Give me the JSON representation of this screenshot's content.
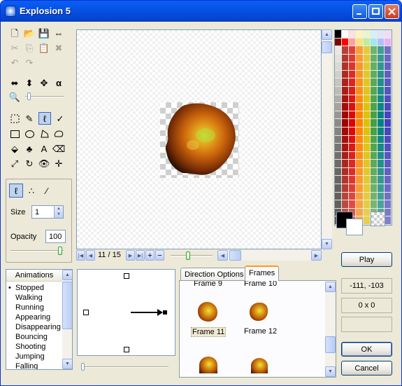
{
  "window": {
    "title": "Explosion 5"
  },
  "tools": {
    "file_row": [
      "new-icon",
      "open-icon",
      "save-icon",
      "resize-icon"
    ],
    "edit_row": [
      "cut-icon",
      "copy-icon",
      "paste-icon",
      "delete-icon"
    ],
    "undo_row": [
      "undo-icon",
      "redo-icon"
    ],
    "transform_row": [
      "flip-horizontal-icon",
      "flip-vertical-icon",
      "scale-icon",
      "alpha-icon"
    ],
    "zoom_icon": "magnifier-icon"
  },
  "brush": {
    "size_label": "Size",
    "size_value": "1",
    "opacity_label": "Opacity",
    "opacity_value": "100",
    "opacity_level": 0.95
  },
  "frame_nav": {
    "counter": "11 / 15",
    "zoom_level": 0.4
  },
  "animations": {
    "header": "Animations",
    "items": [
      "Stopped",
      "Walking",
      "Running",
      "Appearing",
      "Disappearing",
      "Bouncing",
      "Shooting",
      "Jumping",
      "Falling"
    ],
    "selected": "Stopped"
  },
  "tabs": [
    {
      "label": "Direction Options"
    },
    {
      "label": "Frames"
    }
  ],
  "frames": [
    {
      "label": "Frame 9"
    },
    {
      "label": "Frame 10"
    },
    {
      "label": "Frame 11"
    },
    {
      "label": "Frame 12"
    }
  ],
  "selected_frame": "Frame 11",
  "status": {
    "coords": "-111, -103",
    "size": "0 x 0",
    "extra": ""
  },
  "buttons": {
    "play": "Play",
    "ok": "OK",
    "cancel": "Cancel"
  },
  "colors": {
    "title_bar": "#0a5ef3",
    "accent_tab": "#ff9b1a"
  }
}
